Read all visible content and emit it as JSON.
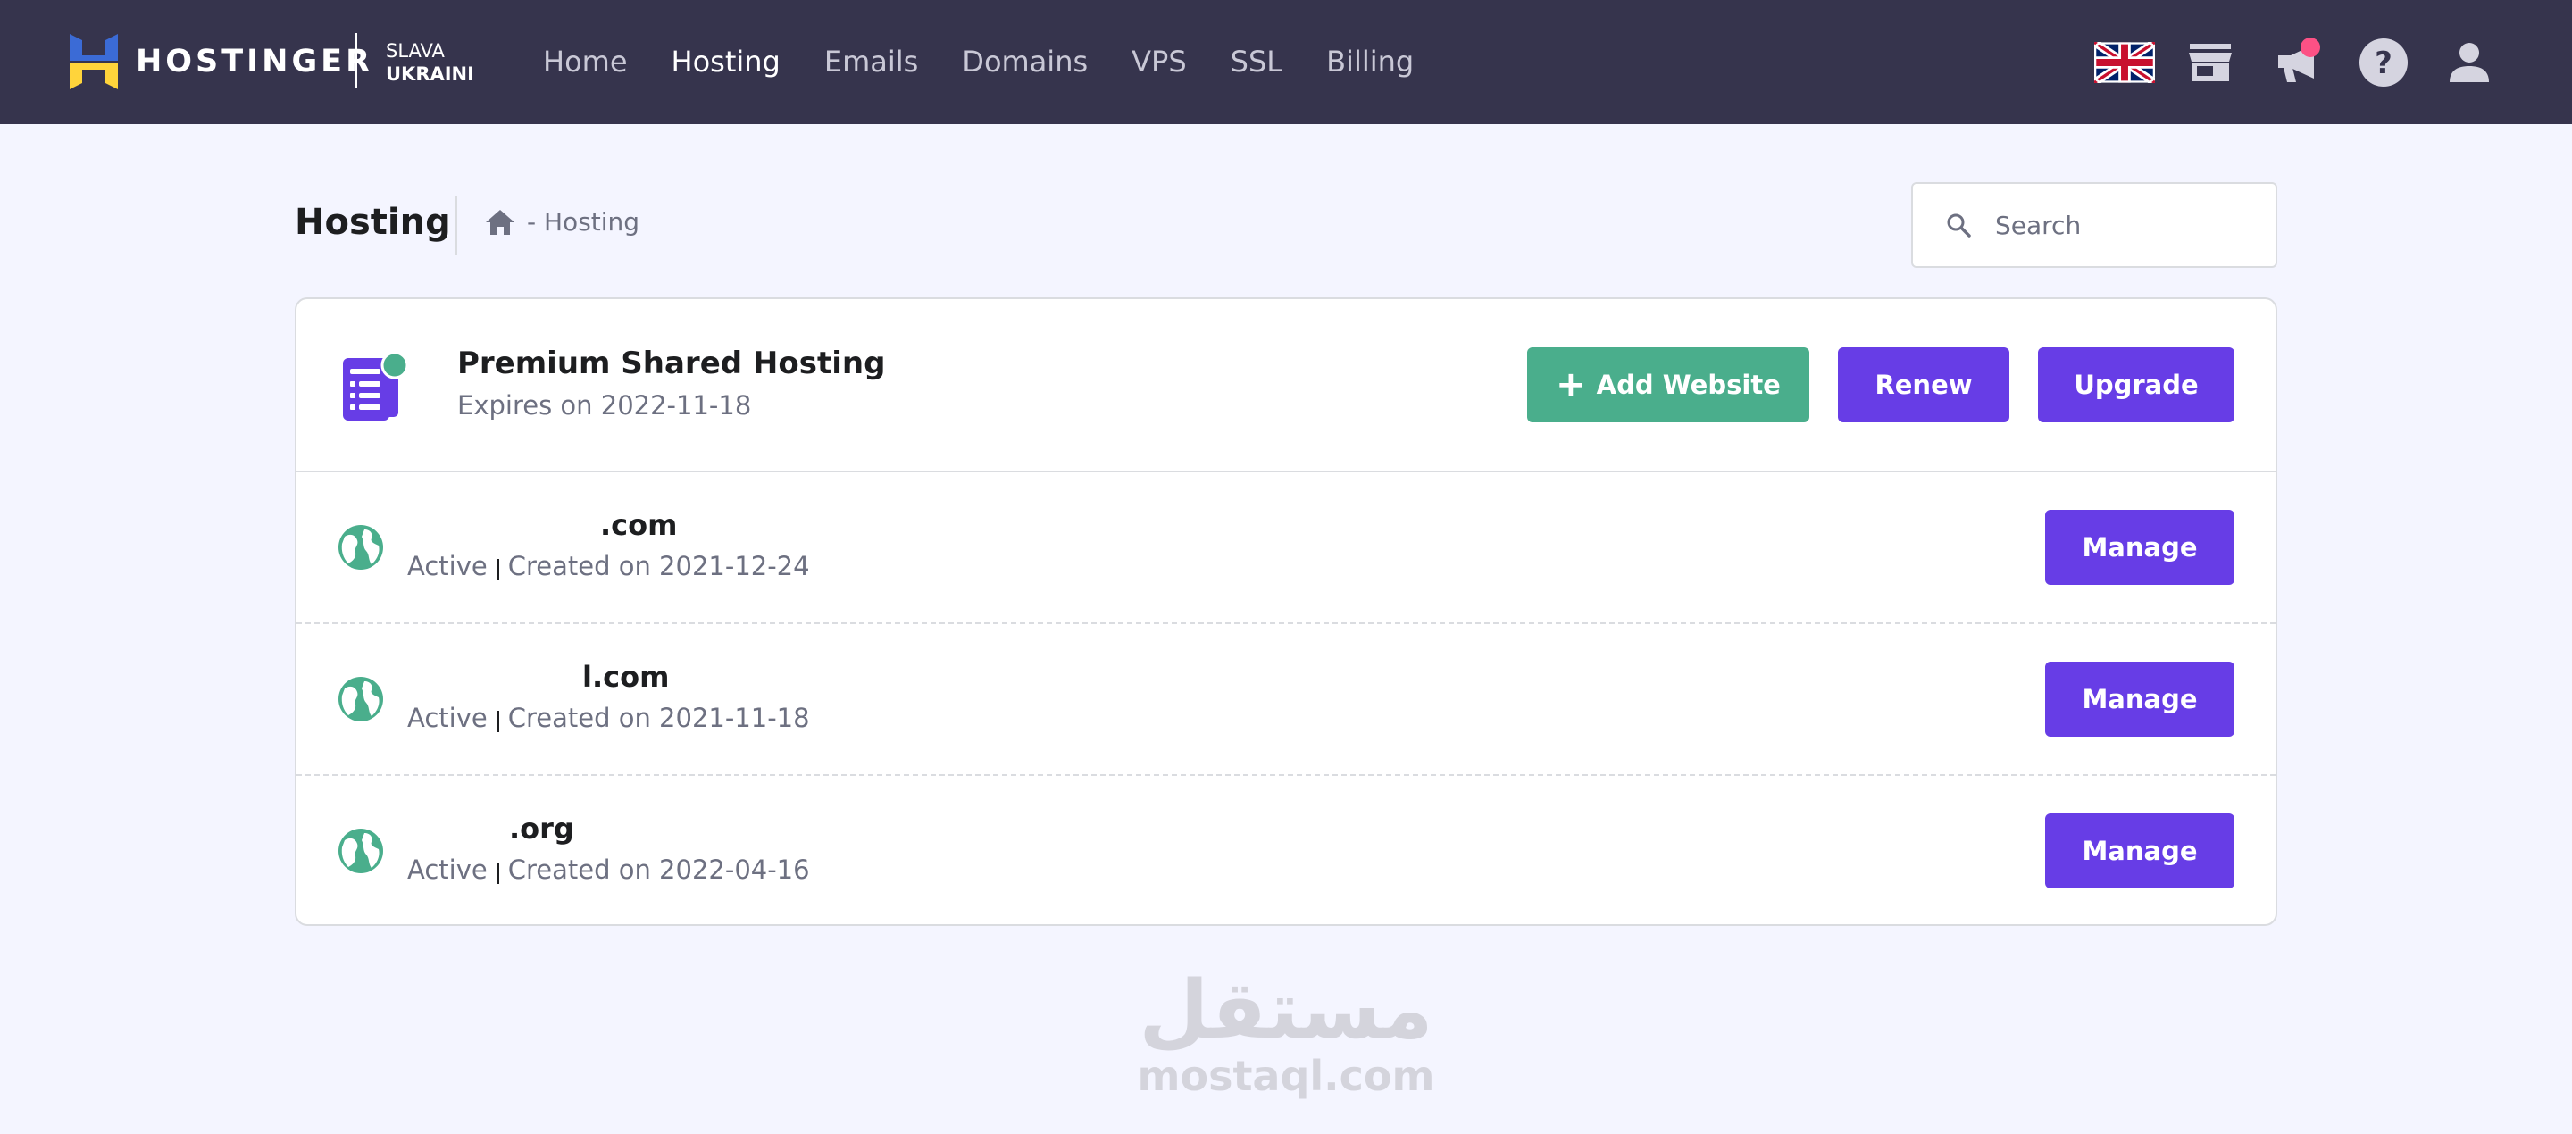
{
  "brand": {
    "name": "HOSTINGER",
    "slogan_line1": "SLAVA",
    "slogan_line2": "UKRAINI",
    "colors": {
      "topbar": "#36344d",
      "accent": "#673de6",
      "success": "#4aae8c",
      "page_bg": "#f4f5ff"
    }
  },
  "nav": {
    "items": [
      {
        "label": "Home",
        "active": false
      },
      {
        "label": "Hosting",
        "active": true
      },
      {
        "label": "Emails",
        "active": false
      },
      {
        "label": "Domains",
        "active": false
      },
      {
        "label": "VPS",
        "active": false
      },
      {
        "label": "SSL",
        "active": false
      },
      {
        "label": "Billing",
        "active": false
      }
    ]
  },
  "top_icons": [
    "uk-flag-icon",
    "store-icon",
    "announcement-icon",
    "help-icon",
    "user-icon"
  ],
  "header": {
    "title": "Hosting",
    "breadcrumb": "- Hosting",
    "search_placeholder": "Search"
  },
  "plan": {
    "name": "Premium Shared Hosting",
    "expires": "Expires on 2022-11-18",
    "buttons": {
      "add_website": "Add Website",
      "renew": "Renew",
      "upgrade": "Upgrade"
    }
  },
  "websites": [
    {
      "domain": ".com",
      "status": "Active",
      "created": "Created on 2021-12-24",
      "manage": "Manage"
    },
    {
      "domain": "l.com",
      "status": "Active",
      "created": "Created on 2021-11-18",
      "manage": "Manage"
    },
    {
      "domain": ".org",
      "status": "Active",
      "created": "Created on 2022-04-16",
      "manage": "Manage"
    }
  ],
  "watermark": {
    "arabic": "مستقل",
    "latin": "mostaql.com"
  }
}
